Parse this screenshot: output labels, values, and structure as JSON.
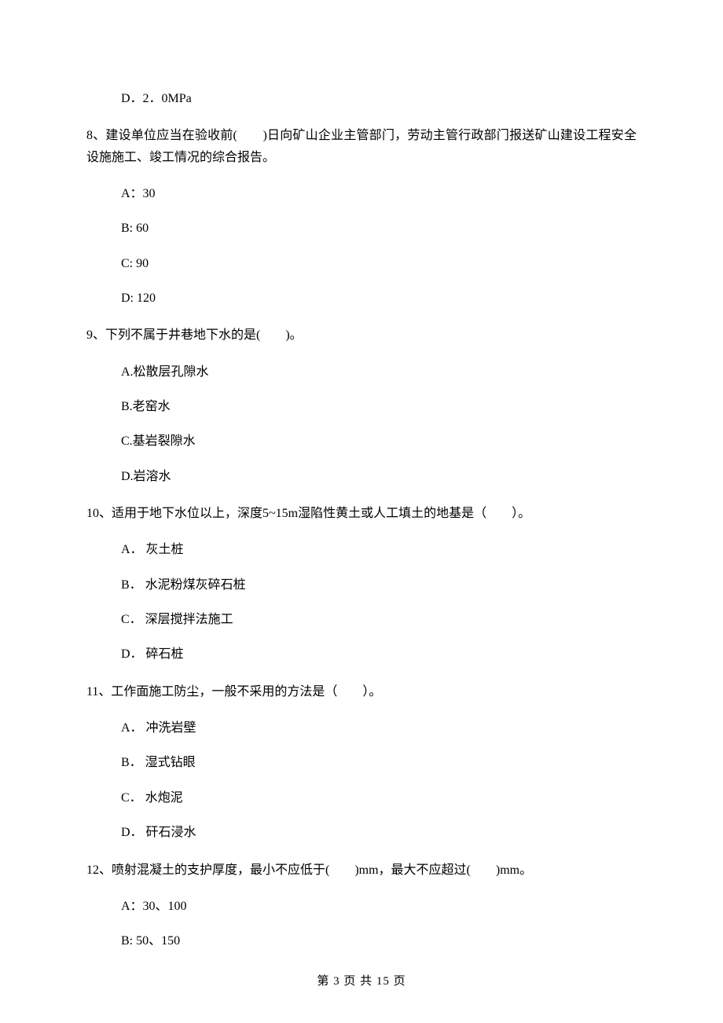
{
  "q7_trailing_option": {
    "D": "D．2．0MPa"
  },
  "questions": [
    {
      "id": "q8",
      "text": "8、建设单位应当在验收前(　　)日向矿山企业主管部门，劳动主管行政部门报送矿山建设工程安全设施施工、竣工情况的综合报告。",
      "options": {
        "A": "A：30",
        "B": "B: 60",
        "C": "C: 90",
        "D": "D: 120"
      }
    },
    {
      "id": "q9",
      "text": "9、下列不属于井巷地下水的是(　　)。",
      "options": {
        "A": "A.松散层孔隙水",
        "B": "B.老窑水",
        "C": "C.基岩裂隙水",
        "D": "D.岩溶水"
      }
    },
    {
      "id": "q10",
      "text": "10、适用于地下水位以上，深度5~15m湿陷性黄土或人工填土的地基是（　　）。",
      "options": {
        "A": "A． 灰土桩",
        "B": "B． 水泥粉煤灰碎石桩",
        "C": "C． 深层搅拌法施工",
        "D": "D． 碎石桩"
      }
    },
    {
      "id": "q11",
      "text": "11、工作面施工防尘，一般不采用的方法是（　　）。",
      "options": {
        "A": "A． 冲洗岩壁",
        "B": "B． 湿式钻眼",
        "C": "C． 水炮泥",
        "D": "D． 矸石浸水"
      }
    },
    {
      "id": "q12",
      "text": "12、喷射混凝土的支护厚度，最小不应低于(　　)mm，最大不应超过(　　)mm。",
      "options": {
        "A": "A：30、100",
        "B": "B: 50、150"
      }
    }
  ],
  "footer": "第 3 页 共 15 页"
}
